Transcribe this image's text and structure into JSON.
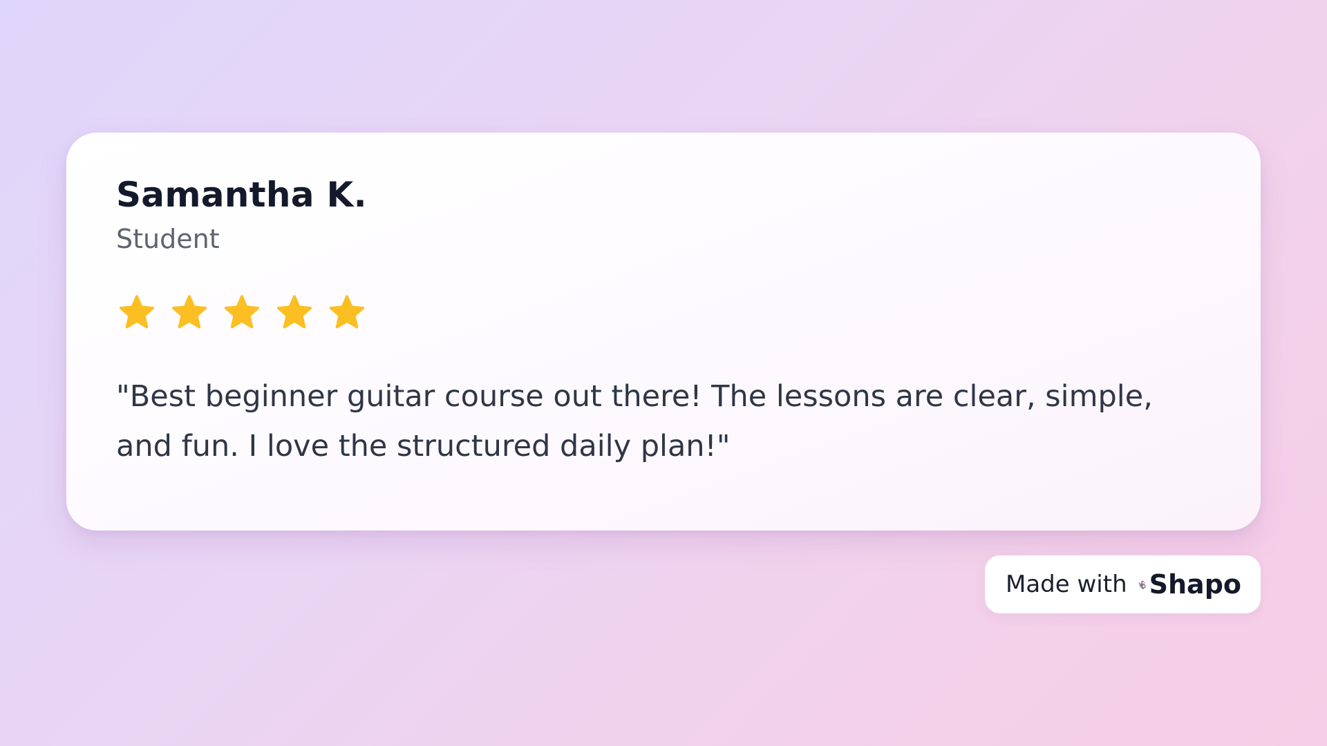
{
  "review": {
    "author_name": "Samantha K.",
    "author_role": "Student",
    "rating": 5,
    "rating_max": 5,
    "star_color": "#FBBF24",
    "text": "\"Best beginner guitar course out there! The lessons are clear, simple, and fun. I love the structured daily plan!\""
  },
  "badge": {
    "prefix": "Made with",
    "brand": "Shapo",
    "icon": "clapping-hands-heart-icon",
    "heart_color": "#EC4899"
  }
}
